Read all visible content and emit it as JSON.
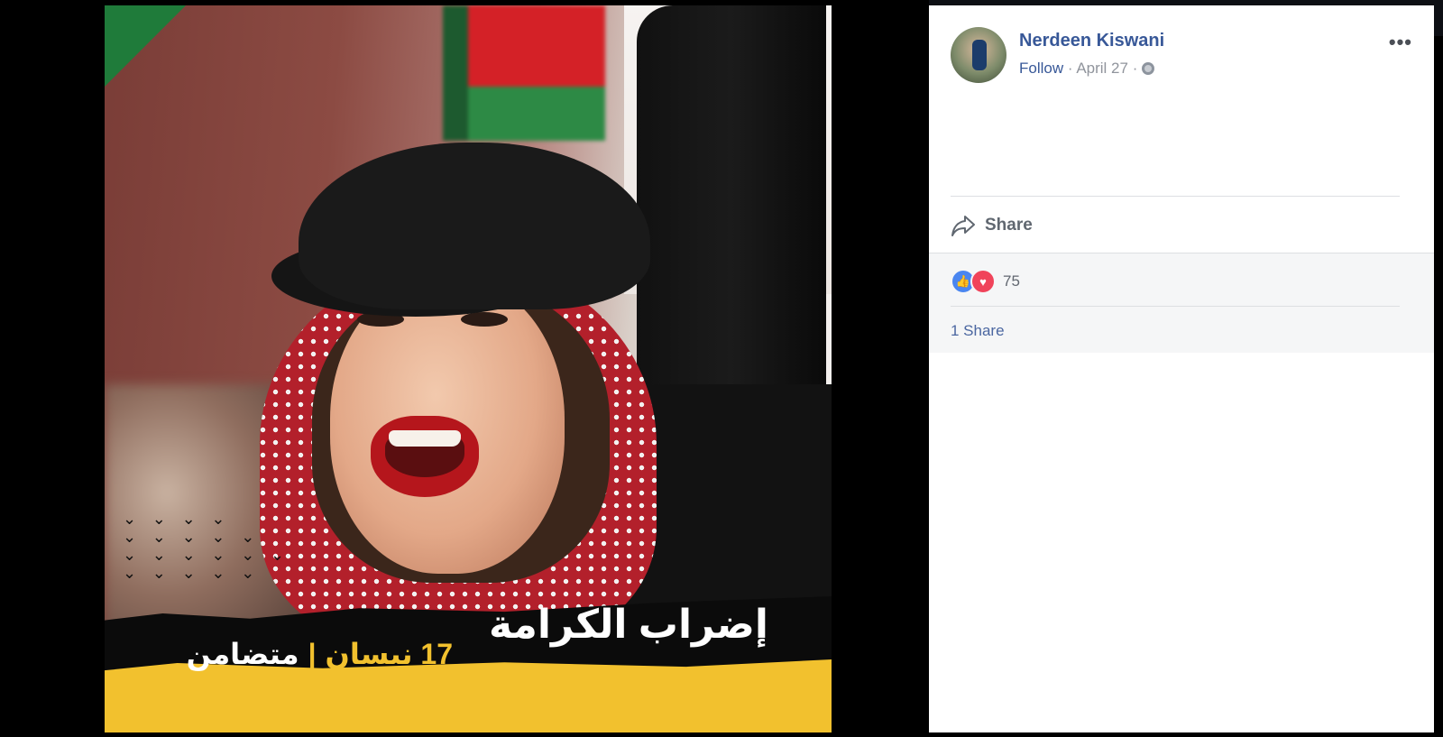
{
  "post": {
    "author": "Nerdeen Kiswani",
    "follow_label": "Follow",
    "separator": "·",
    "date": "April 27",
    "more_icon": "more-icon",
    "share_label": "Share",
    "reaction_count": "75",
    "share_count": "1 Share"
  },
  "image": {
    "headline": "إضراب الكرامة",
    "date_text": "17 نيسان",
    "separator": "|",
    "solidarity_text": "متضامن"
  },
  "colors": {
    "link_blue": "#385898",
    "like_blue": "#4a86f0",
    "love_red": "#f0435a",
    "banner_yellow": "#f2c12e"
  }
}
